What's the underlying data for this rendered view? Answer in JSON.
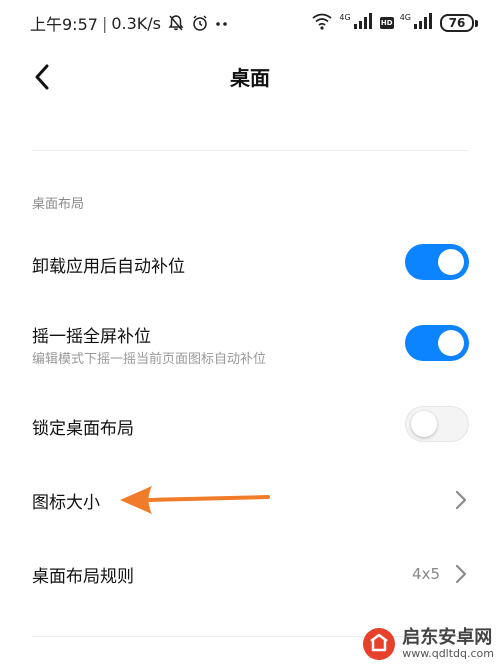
{
  "status_bar": {
    "time": "上午9:57",
    "speed": "0.3K/s",
    "network_1": "4G",
    "network_2": "4G",
    "hd": "HD",
    "battery": "76"
  },
  "header": {
    "title": "桌面"
  },
  "section": {
    "title": "桌面布局"
  },
  "settings": {
    "auto_fill_after_uninstall": {
      "label": "卸载应用后自动补位",
      "enabled": true
    },
    "shake_fill": {
      "label": "摇一摇全屏补位",
      "description": "编辑模式下摇一摇当前页面图标自动补位",
      "enabled": true
    },
    "lock_layout": {
      "label": "锁定桌面布局",
      "enabled": false
    },
    "icon_size": {
      "label": "图标大小"
    },
    "layout_rule": {
      "label": "桌面布局规则",
      "value": "4x5"
    }
  },
  "colors": {
    "toggle_on": "#0d84ff",
    "annotation_arrow": "#f07c2a",
    "watermark_red": "#e8412b"
  },
  "watermark": {
    "name": "启东安卓网",
    "url": "www.qdltdq.com"
  }
}
